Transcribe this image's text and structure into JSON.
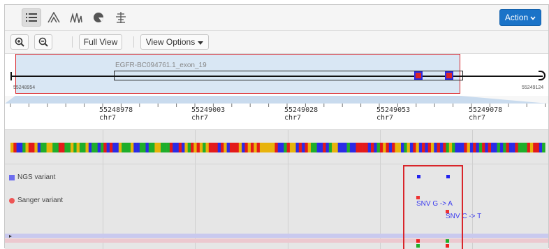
{
  "toolbar": {
    "icons": [
      "list-icon",
      "peak-icon",
      "wave-icon",
      "pie-icon",
      "tree-icon"
    ],
    "action_label": "Action"
  },
  "controls": {
    "zoom_in": "zoom-in-icon",
    "zoom_out": "zoom-out-icon",
    "full_view_label": "Full View",
    "view_options_label": "View Options"
  },
  "overview": {
    "feature_label": "EGFR-BC094761.1_exon_19",
    "start_coord": "55248954",
    "end_coord": "55249124"
  },
  "ruler": {
    "ticks": [
      {
        "pos": "55248978",
        "chr": "chr7"
      },
      {
        "pos": "55249003",
        "chr": "chr7"
      },
      {
        "pos": "55249028",
        "chr": "chr7"
      },
      {
        "pos": "55249053",
        "chr": "chr7"
      },
      {
        "pos": "55249078",
        "chr": "chr7"
      }
    ]
  },
  "tracks": {
    "ngs_label": "NGS variant",
    "sanger_label": "Sanger variant",
    "snv1_label": "SNV G -> A",
    "snv2_label": "SNV C -> T"
  },
  "colors": {
    "action_bg": "#1a73c8",
    "highlight_red": "#d9252a",
    "ngs_blue": "#2222ee",
    "sanger_red": "#ee3333",
    "base_A": "#1fae2a",
    "base_C": "#2b2be6",
    "base_G": "#e8b30c",
    "base_T": "#e31a1a"
  }
}
